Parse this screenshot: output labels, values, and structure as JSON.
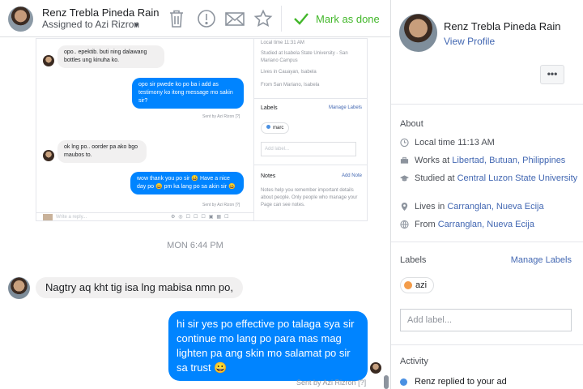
{
  "header": {
    "contact_name": "Renz Trebla Pineda Rain",
    "assigned_text": "Assigned to Azi Rizron",
    "mark_done_label": "Mark as done",
    "icons": [
      "trash-icon",
      "alert-icon",
      "envelope-icon",
      "star-icon",
      "checkmark-icon"
    ]
  },
  "embedded": {
    "messages": [
      {
        "side": "in",
        "text": "opo.. epektib. buti ning dalawang bottles ung kinuha ko."
      },
      {
        "side": "out",
        "text": "opo sir pwede ko po ba i add as testimony ko itong message mo sakin sir?",
        "sent": "Sent by Azi Rizon [?]"
      },
      {
        "side": "in",
        "text": "ok lng po.. oorder pa ako bgo maubos to."
      },
      {
        "side": "out",
        "text": "wow thank you po sir 😀 Have a nice day po 😀 pm ka lang po sa akin sir 😀",
        "sent": "Sent by Azi Rizon [?]"
      }
    ],
    "composer_placeholder": "Write a reply...",
    "info": {
      "local_time": "Local time 11:31 AM",
      "studied": "Studied at Isabela State University - San Mariano Campus",
      "lives": "Lives in Cauayan, Isabela",
      "from": "From San Mariano, Isabela"
    },
    "labels_title": "Labels",
    "manage_labels": "Manage Labels",
    "label_tag": "marc",
    "add_label_placeholder": "Add label...",
    "notes_title": "Notes",
    "add_note": "Add Note",
    "notes_help": "Notes help you remember important details about people. Only people who manage your Page can see notes."
  },
  "conversation": {
    "timestamp": "MON 6:44 PM",
    "incoming_message": "Nagtry aq kht tig isa lng mabisa nmn po,",
    "outgoing_message": "hi sir yes po effective po talaga sya sir continue mo lang po para mas mag lighten pa ang skin mo salamat po sir sa trust 😀",
    "sent_by": "Sent by Azi Rizron",
    "help_mark": "[?]"
  },
  "panel": {
    "name": "Renz Trebla Pineda Rain",
    "view_profile": "View Profile",
    "more_button": "•••",
    "about_title": "About",
    "local_time": "Local time 11:13 AM",
    "works_prefix": "Works at ",
    "works_link": "Libertad, Butuan, Philippines",
    "studied_prefix": "Studied at ",
    "studied_link": "Central Luzon State University",
    "lives_prefix": "Lives in ",
    "lives_link": "Carranglan, Nueva Ecija",
    "from_prefix": "From ",
    "from_link": "Carranglan, Nueva Ecija",
    "labels_title": "Labels",
    "manage_labels": "Manage Labels",
    "label_tag": "azi",
    "add_label_placeholder": "Add label...",
    "activity_title": "Activity",
    "activity_item": "Renz replied to your ad"
  },
  "colors": {
    "accent_blue": "#0084ff",
    "link_blue": "#4267b2",
    "done_green": "#42b72a",
    "label_orange": "#f39c4a"
  }
}
